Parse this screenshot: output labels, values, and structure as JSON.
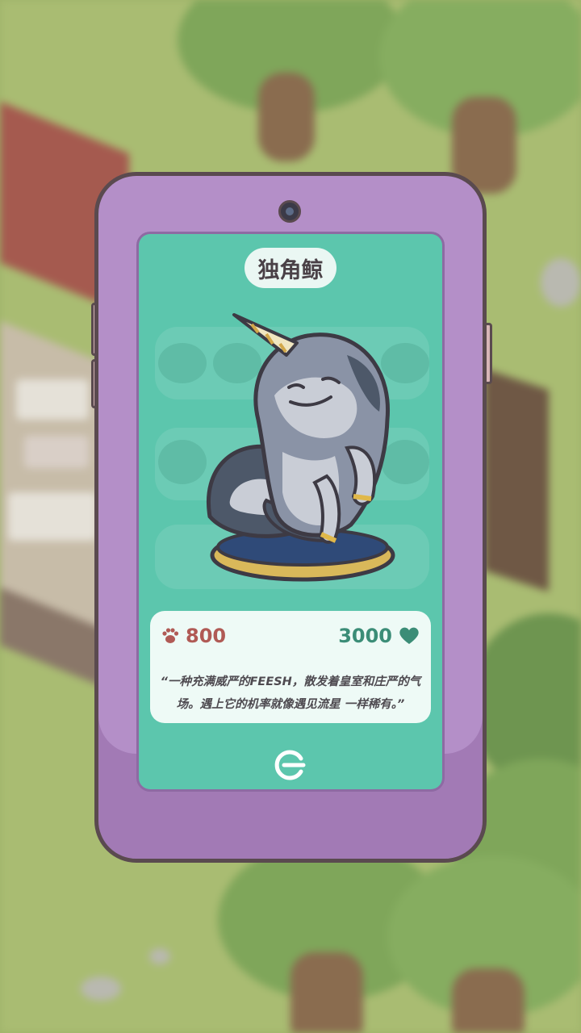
{
  "creature": {
    "name": "独角鲸",
    "cost": "800",
    "value": "3000",
    "description": "“一种充满威严的FEESH，散发着皇室和庄严的气场。遇上它的机率就像遇见流星 一样稀有。”"
  },
  "icons": {
    "cost": "paw-icon",
    "value": "heart-icon",
    "exit": "exit-icon",
    "camera": "camera-icon"
  },
  "colors": {
    "phone_body": "#b48fc8",
    "screen": "#5cc6ad",
    "cost_red": "#b05a55",
    "value_green": "#3b8d77"
  }
}
